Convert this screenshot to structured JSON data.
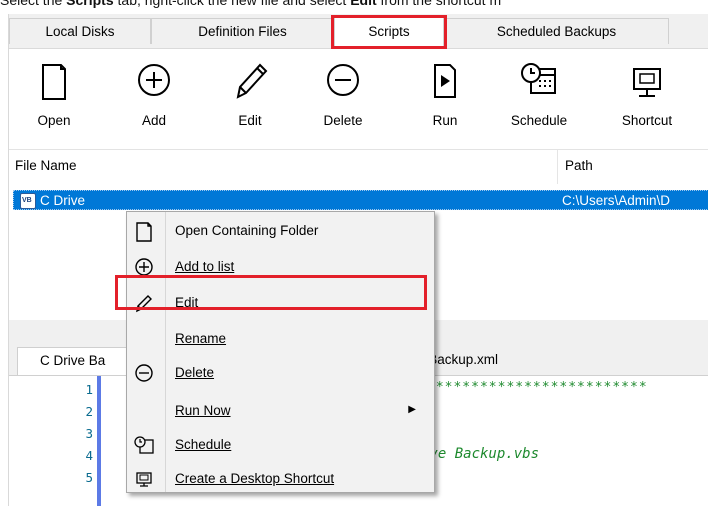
{
  "caption": {
    "prefix": "Select the ",
    "bold1": "Scripts",
    "middle": " tab, right-click the new file and select ",
    "bold2": "Edit",
    "suffix": " from the shortcut m"
  },
  "tabs": [
    "Local Disks",
    "Definition Files",
    "Scripts",
    "Scheduled Backups"
  ],
  "toolbar": {
    "open": "Open",
    "add": "Add",
    "edit": "Edit",
    "delete": "Delete",
    "run": "Run",
    "schedule": "Schedule",
    "shortcut": "Shortcut"
  },
  "filelist": {
    "col_name": "File Name",
    "col_path": "Path",
    "row_name": "C Drive",
    "row_path": "C:\\Users\\Admin\\D",
    "file_badge": "VB"
  },
  "editor_tabs": {
    "tab1": "C Drive Ba",
    "tab2": "e Backup.xml"
  },
  "editor": {
    "line_numbers": [
      "1",
      "2",
      "3",
      "4",
      "5"
    ],
    "line1": "*************************",
    "line4": "ive Backup.vbs"
  },
  "context_menu": {
    "open_folder": "Open Containing Folder",
    "add_to_list": "Add to list",
    "edit": "Edit",
    "rename": "Rename",
    "delete": "Delete",
    "run_now": "Run Now",
    "schedule": "Schedule",
    "desktop_shortcut": "Create a Desktop Shortcut"
  },
  "colors": {
    "highlight": "#e3202a",
    "selection": "#0078d7"
  }
}
